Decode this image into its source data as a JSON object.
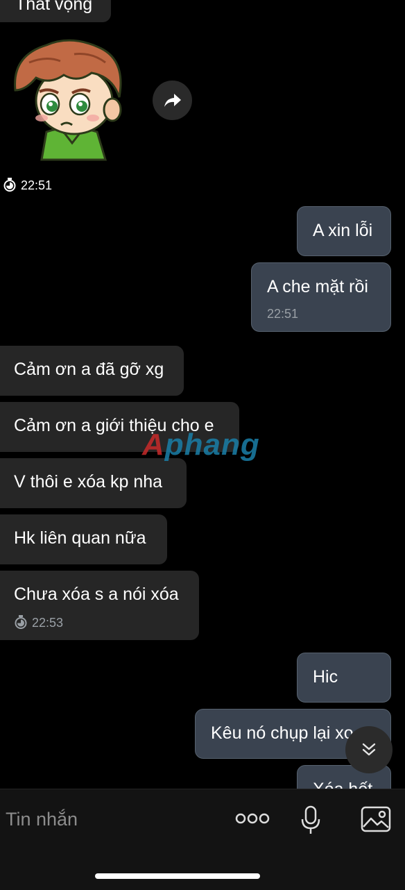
{
  "messages": [
    {
      "dir": "in",
      "text": "Thất vọng"
    },
    {
      "dir": "in",
      "type": "sticker",
      "sticker": "sad-boy-sticker",
      "time": "22:51"
    },
    {
      "dir": "out",
      "text": "A xin lỗi"
    },
    {
      "dir": "out",
      "text": "A che mặt rồi",
      "time": "22:51"
    },
    {
      "dir": "in",
      "text": "Cảm ơn a đã gỡ xg"
    },
    {
      "dir": "in",
      "text": "Cảm ơn a giới thiệu cho e"
    },
    {
      "dir": "in",
      "text": "V thôi e xóa kp nha"
    },
    {
      "dir": "in",
      "text": "Hk liên quan nữa"
    },
    {
      "dir": "in",
      "text": "Chưa xóa s a nói xóa",
      "time": "22:53"
    },
    {
      "dir": "out",
      "text": "Hic"
    },
    {
      "dir": "out",
      "text": "Kêu nó chụp lại xo"
    },
    {
      "dir": "out",
      "text": "Xóa hết"
    }
  ],
  "watermark": {
    "first": "A",
    "rest": "phang"
  },
  "composer": {
    "placeholder": "Tin nhắn",
    "icons": [
      "more-icon",
      "microphone-icon",
      "image-icon"
    ]
  },
  "icons": {
    "share": "share-icon",
    "scroll_down": "chevron-double-down-icon",
    "timer": "stopwatch-icon"
  },
  "colors": {
    "background": "#000000",
    "incoming_bubble": "#262626",
    "outgoing_bubble": "#3a4350",
    "meta_text": "#9aa0a6"
  }
}
